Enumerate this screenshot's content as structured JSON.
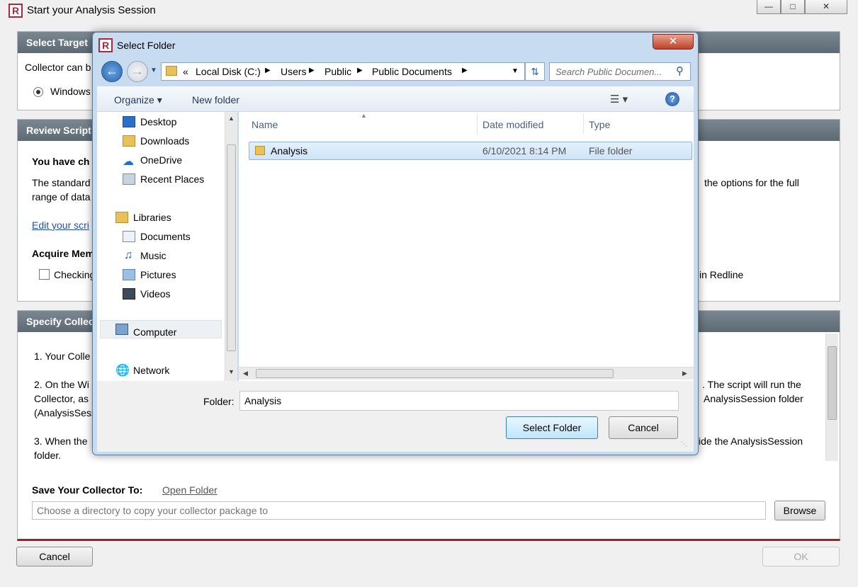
{
  "main": {
    "title": "Start your Analysis Session",
    "logo": "R",
    "sections": {
      "target": {
        "heading": "Select Target",
        "line": "Collector can b",
        "radio_label": "Windows"
      },
      "review": {
        "heading": "Review Script",
        "bold_left": "You have ch",
        "para_left_1": "The standard",
        "para_left_2": "range of data",
        "para_right": "the options for the full",
        "edit_link": "Edit your scri",
        "acquire_heading": "Acquire Mem",
        "checkbox_label": "Checking",
        "checkbox_right": "in Redline"
      },
      "specify": {
        "heading": "Specify Collec",
        "step1": "1. Your Colle",
        "step2_l1": "2. On the Wi",
        "step2_l2": "Collector, as",
        "step2_l3": "(AnalysisSess",
        "step2_r1": ". The script will run the",
        "step2_r2": "AnalysisSession folder",
        "step3_l1": "3. When the",
        "step3_l2": "folder.",
        "step3_r1": "ide the AnalysisSession"
      }
    },
    "save": {
      "label": "Save Your Collector To:",
      "open_folder": "Open Folder",
      "placeholder": "Choose a directory to copy your collector package to",
      "browse": "Browse"
    },
    "cancel": "Cancel",
    "ok": "OK",
    "window_buttons": {
      "minimize": "—",
      "restore": "□",
      "close": "✕"
    }
  },
  "dialog": {
    "title": "Select Folder",
    "close": "✕",
    "breadcrumb": [
      "«",
      "Local Disk (C:)",
      "Users",
      "Public",
      "Public Documents"
    ],
    "search_placeholder": "Search Public Documen...",
    "toolbar": {
      "organize": "Organize ▾",
      "new_folder": "New folder"
    },
    "nav": {
      "favorites": [
        "Desktop",
        "Downloads",
        "OneDrive",
        "Recent Places"
      ],
      "libraries": "Libraries",
      "library_items": [
        "Documents",
        "Music",
        "Pictures",
        "Videos"
      ],
      "computer": "Computer",
      "network": "Network"
    },
    "columns": {
      "name": "Name",
      "date": "Date modified",
      "type": "Type"
    },
    "rows": [
      {
        "name": "Analysis",
        "date": "6/10/2021 8:14 PM",
        "type": "File folder"
      }
    ],
    "folder_label": "Folder:",
    "folder_value": "Analysis",
    "select_button": "Select Folder",
    "cancel_button": "Cancel"
  },
  "colors": {
    "brand": "#b0263a",
    "section_header": "#66727c",
    "selection": "#cce8ff",
    "link": "#1f4fb5"
  }
}
